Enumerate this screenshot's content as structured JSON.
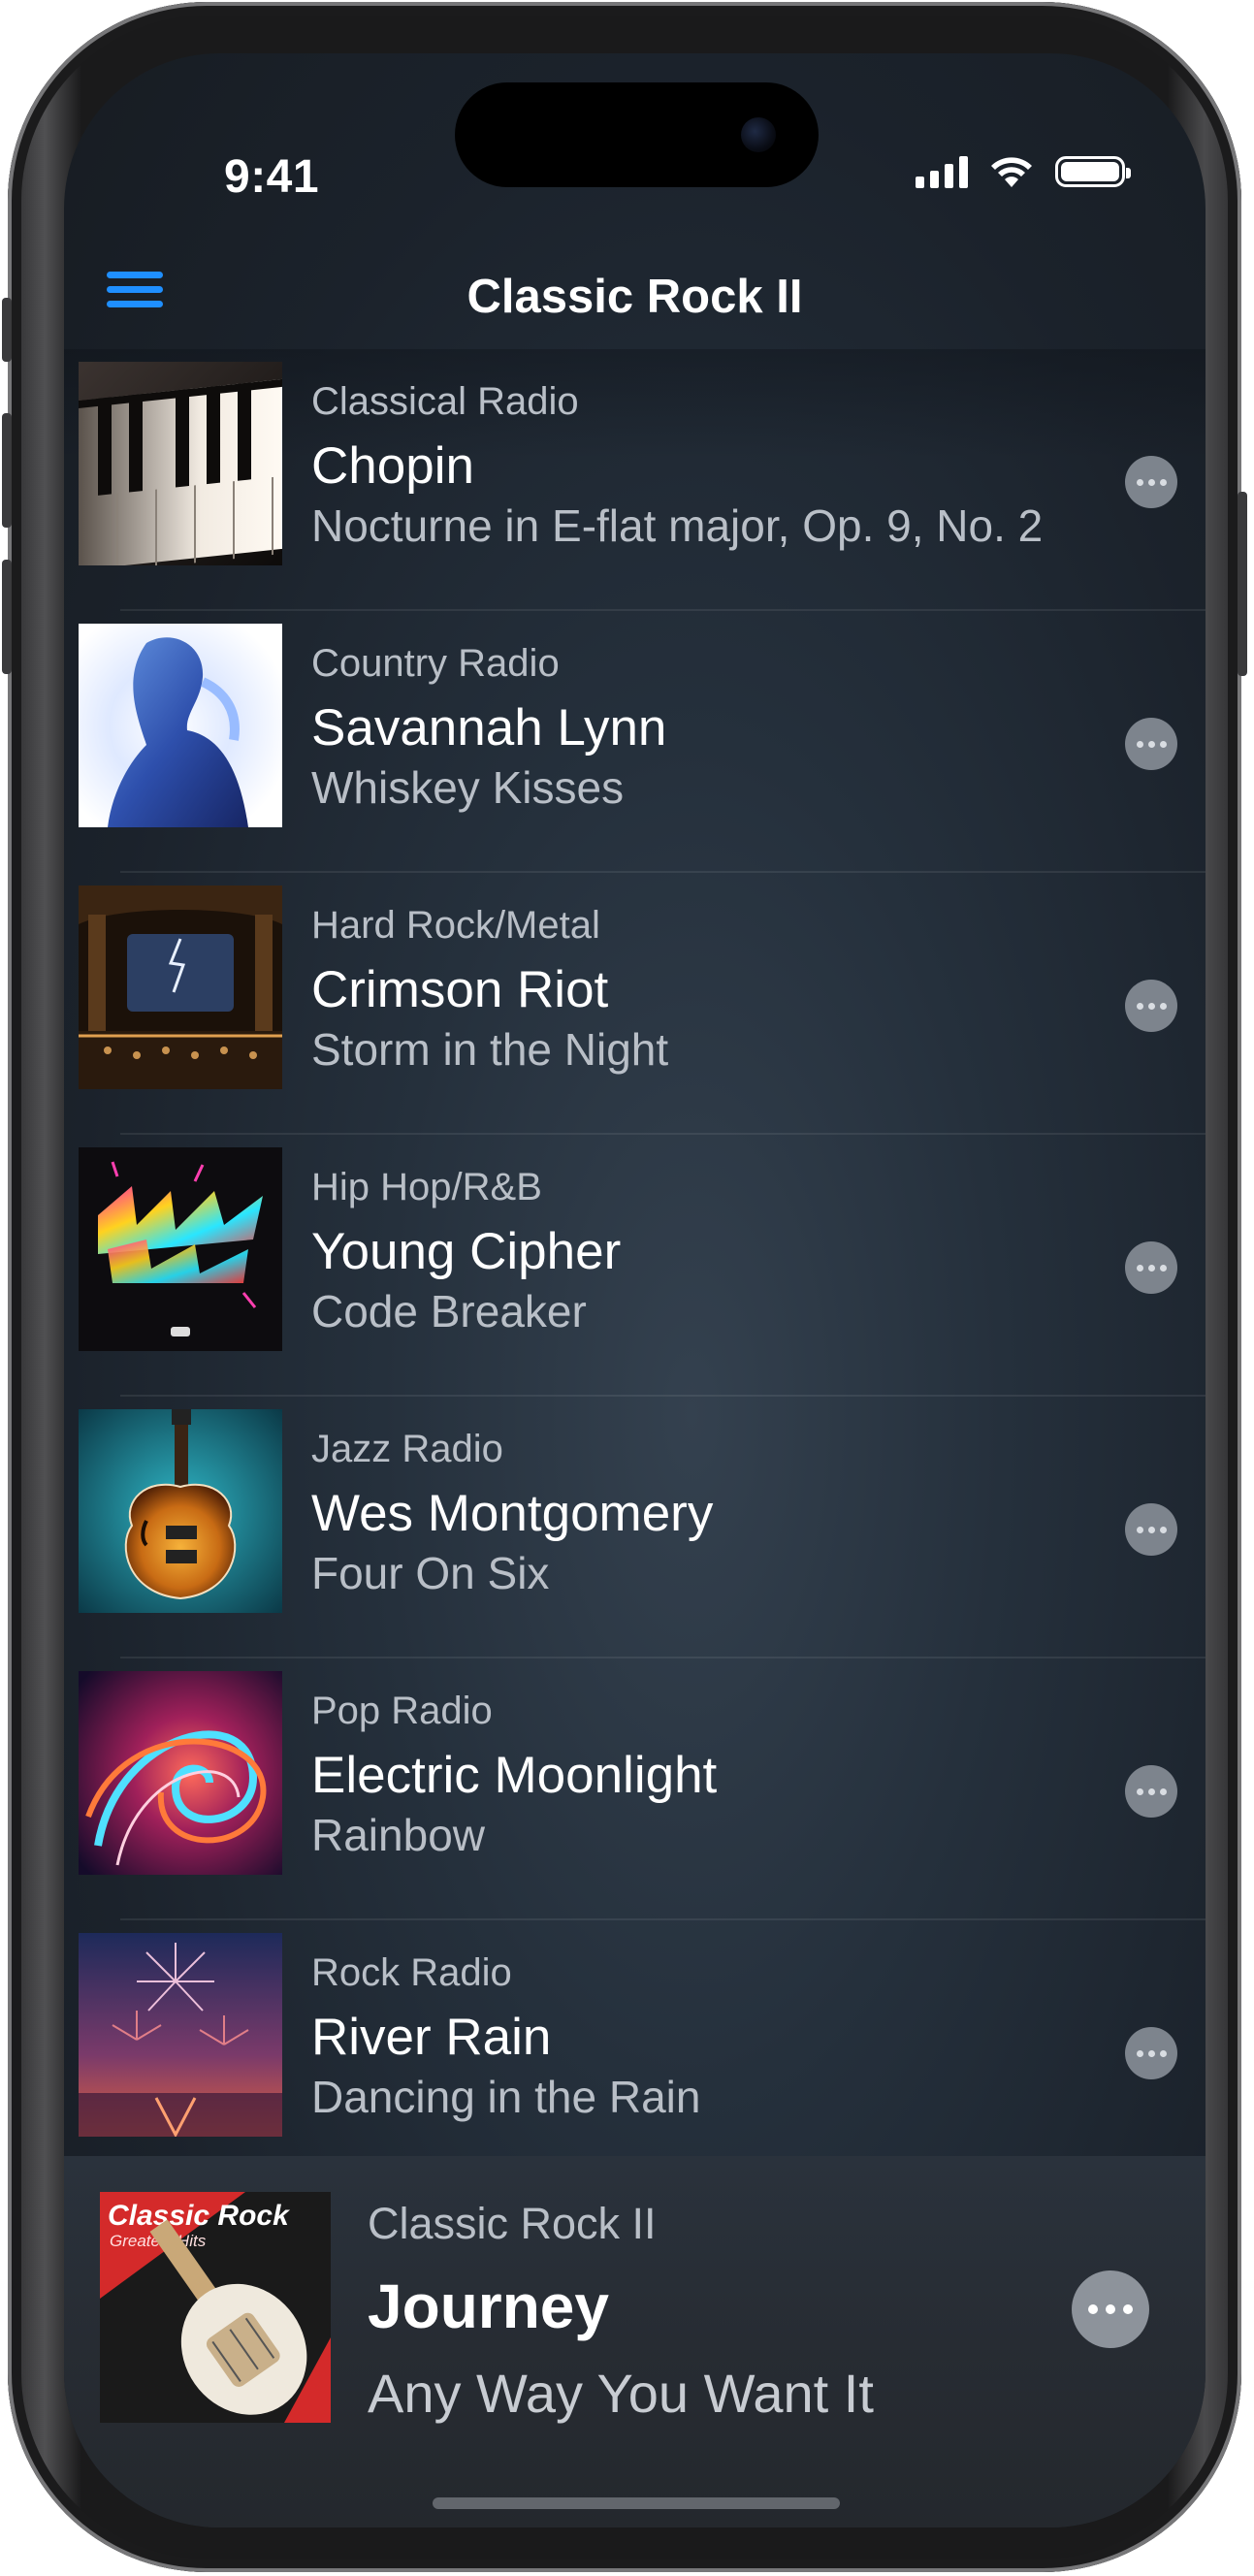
{
  "status_bar": {
    "time": "9:41"
  },
  "navbar": {
    "title": "Classic Rock II"
  },
  "stations": [
    {
      "genre": "Classical Radio",
      "artist": "Chopin",
      "song": "Nocturne in E-flat major, Op. 9, No. 2",
      "art": "piano-keys-image"
    },
    {
      "genre": "Country Radio",
      "artist": "Savannah Lynn",
      "song": "Whiskey Kisses",
      "art": "glowing-woman-silhouette-image"
    },
    {
      "genre": "Hard Rock/Metal",
      "artist": "Crimson Riot",
      "song": "Storm in the Night",
      "art": "concert-hall-storm-image"
    },
    {
      "genre": "Hip Hop/R&B",
      "artist": "Young Cipher",
      "song": "Code Breaker",
      "art": "graffiti-logo-image"
    },
    {
      "genre": "Jazz Radio",
      "artist": "Wes Montgomery",
      "song": "Four On Six",
      "art": "archtop-guitar-image"
    },
    {
      "genre": "Pop Radio",
      "artist": "Electric Moonlight",
      "song": "Rainbow",
      "art": "neon-swirl-image"
    },
    {
      "genre": "Rock Radio",
      "artist": "River Rain",
      "song": "Dancing in the Rain",
      "art": "fireworks-image"
    }
  ],
  "now_playing": {
    "station": "Classic Rock II",
    "artist": "Journey",
    "song": "Any Way You Want It",
    "art_title": "Classic Rock",
    "art_subtitle": "Greatest Hits"
  },
  "icons": {
    "menu": "hamburger-menu-icon",
    "more": "ellipsis-icon",
    "signal": "cellular-signal-icon",
    "wifi": "wifi-icon",
    "battery": "battery-icon"
  },
  "colors": {
    "accent": "#1f8fff",
    "background": "#25303c",
    "secondary_text": "#b9bfc7"
  }
}
